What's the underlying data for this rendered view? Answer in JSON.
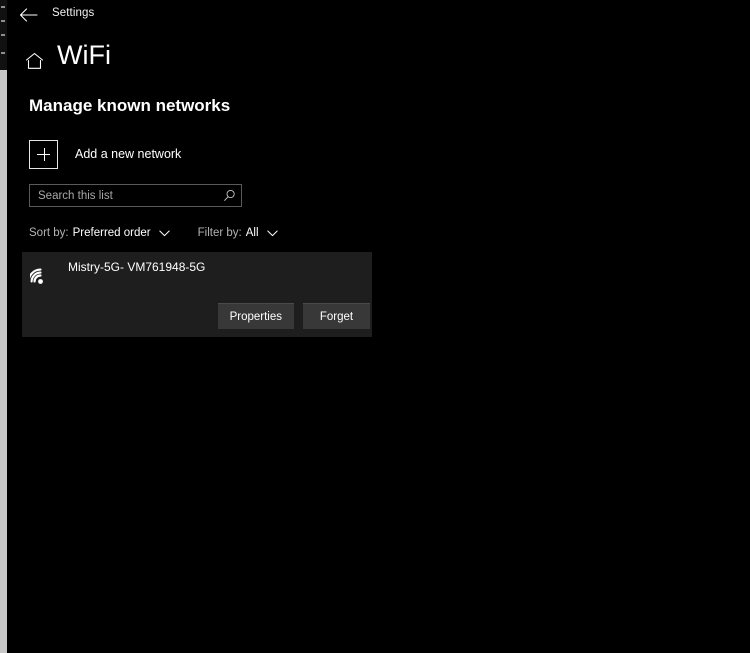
{
  "titlebar": {
    "back_icon": "back-arrow-icon",
    "app_title": "Settings"
  },
  "header": {
    "home_icon": "home-icon",
    "page_title": "WiFi"
  },
  "content": {
    "section_title": "Manage known networks",
    "add_network": {
      "icon": "plus-icon",
      "label": "Add a new network"
    },
    "search": {
      "placeholder": "Search this list",
      "value": "",
      "icon": "search-icon"
    },
    "filters": {
      "sort": {
        "prefix": "Sort by:",
        "value": "Preferred order",
        "chevron": "chevron-down-icon"
      },
      "filter": {
        "prefix": "Filter by:",
        "value": "All",
        "chevron": "chevron-down-icon"
      }
    },
    "networks": [
      {
        "icon": "wifi-signal-icon",
        "name": "Mistry-5G- VM761948-5G",
        "properties_label": "Properties",
        "forget_label": "Forget"
      }
    ]
  },
  "colors": {
    "page_background": "#000000",
    "card_background": "#1e1e1e",
    "button_background": "#383838",
    "text_primary": "#ffffff",
    "text_secondary": "#b4b4b4",
    "border": "#5a5a5a",
    "desktop_strip": "#c8c8c8"
  }
}
